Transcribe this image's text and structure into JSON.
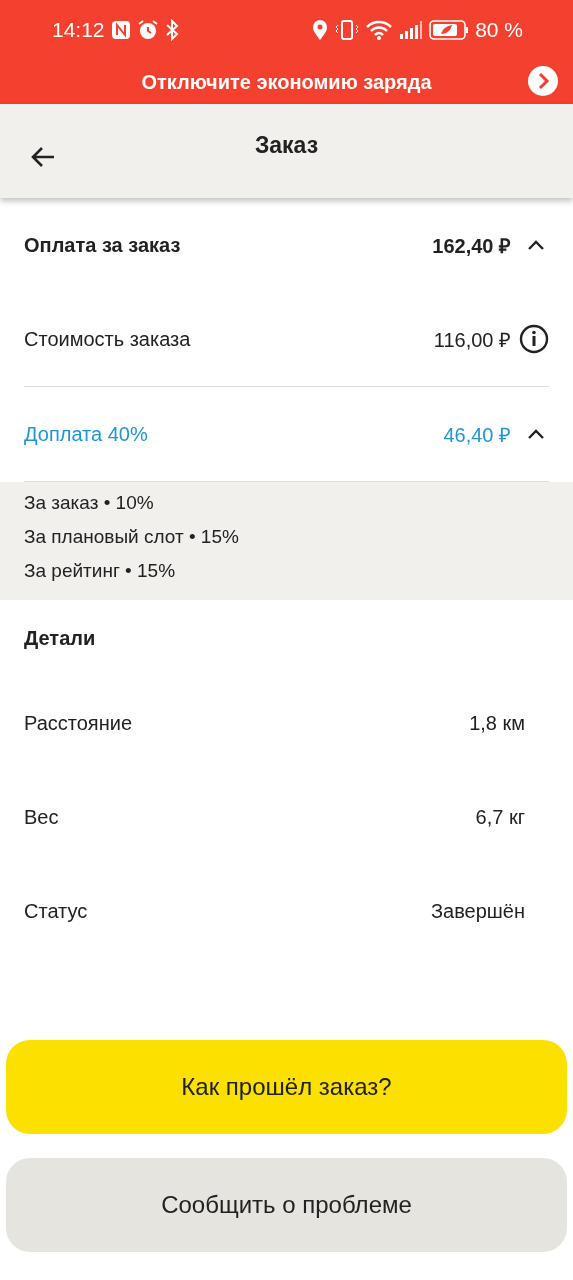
{
  "status_bar": {
    "time": "14:12",
    "battery": "80 %"
  },
  "banner": {
    "text": "Отключите экономию заряда"
  },
  "header": {
    "title": "Заказ"
  },
  "payment": {
    "title": "Оплата за заказ",
    "amount": "162,40 ₽",
    "expanded": true,
    "cost": {
      "label": "Стоимость заказа",
      "amount": "116,00 ₽"
    },
    "surcharge": {
      "label": "Доплата 40%",
      "amount": "46,40 ₽",
      "expanded": true,
      "items": [
        "За заказ • 10%",
        "За плановый слот • 15%",
        "За рейтинг • 15%"
      ]
    }
  },
  "details": {
    "title": "Детали",
    "rows": [
      {
        "label": "Расстояние",
        "value": "1,8 км"
      },
      {
        "label": "Вес",
        "value": "6,7 кг"
      },
      {
        "label": "Статус",
        "value": "Завершён"
      }
    ]
  },
  "buttons": [
    {
      "label": "Как прошёл заказ?",
      "kind": "primary"
    },
    {
      "label": "Сообщить о проблеме",
      "kind": "secondary"
    }
  ]
}
